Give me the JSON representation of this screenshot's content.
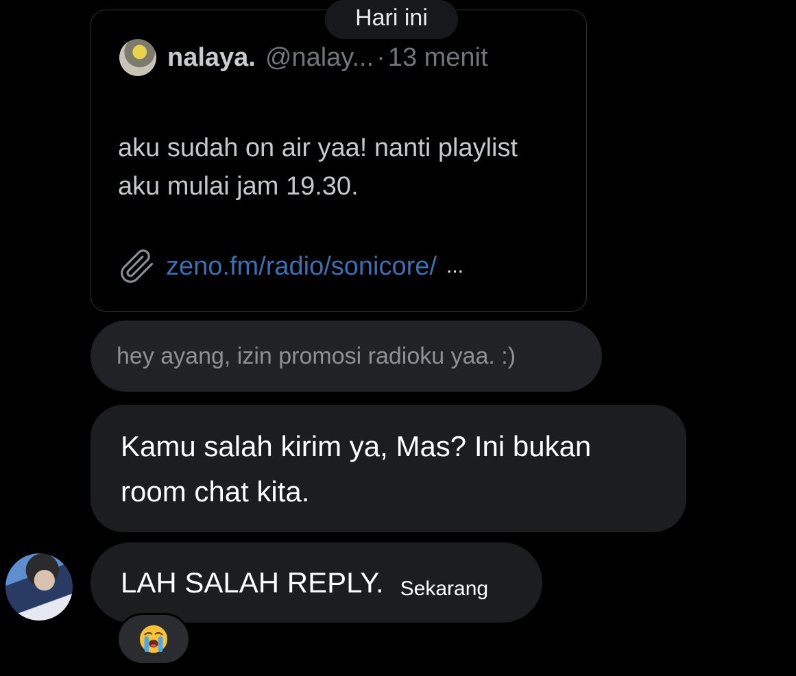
{
  "date_separator": "Hari ini",
  "tweet": {
    "name": "nalaya.",
    "handle": "@nalay...",
    "time": "13 menit",
    "text": "aku sudah on air yaa! nanti playlist aku mulai jam 19.30.",
    "link": "zeno.fm/radio/sonicore/",
    "link_ellipsis": "..."
  },
  "messages": [
    {
      "text": "hey ayang, izin promosi radioku yaa. :)"
    },
    {
      "text": "Kamu salah kirim ya, Mas? Ini bukan room chat kita."
    },
    {
      "text": "LAH SALAH REPLY.",
      "time": "Sekarang"
    }
  ],
  "reaction": {
    "icon": "loudly-crying-face-icon"
  },
  "colors": {
    "background": "#000000",
    "bubble": "#1c1d1f",
    "link": "#3d6fb3",
    "muted": "#71767b"
  }
}
